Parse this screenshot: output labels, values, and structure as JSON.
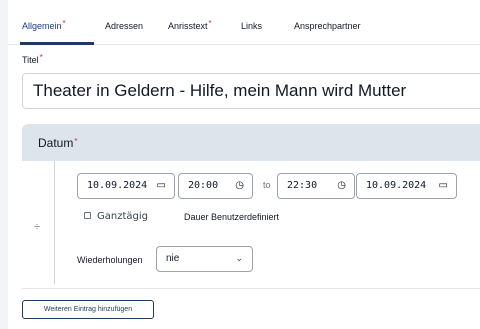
{
  "tabs": [
    {
      "label": "Allgemein",
      "required": "*"
    },
    {
      "label": "Adressen",
      "required": ""
    },
    {
      "label": "Anrisstext",
      "required": "*"
    },
    {
      "label": "Links",
      "required": ""
    },
    {
      "label": "Ansprechpartner",
      "required": ""
    }
  ],
  "title_field": {
    "label": "Titel",
    "required": "*",
    "value": "Theater in Geldern - Hilfe, mein Mann wird Mutter"
  },
  "datum": {
    "label": "Datum",
    "required": "*",
    "start_date": "10.09.2024",
    "start_time": "20:00",
    "separator": "to",
    "end_time": "22:30",
    "end_date": "10.09.2024",
    "all_day_label": "Ganztägig",
    "custom_duration_label": "Dauer Benutzerdefiniert",
    "repeat_label": "Wiederholungen",
    "repeat_value": "nie",
    "drag_handle_icon": "drag-handle-icon",
    "calendar_icon": "calendar-icon",
    "clock_icon": "clock-icon",
    "chevron_icon": "chevron-down-icon"
  },
  "add_entry_button": "Weiteren Eintrag hinzufügen",
  "colors": {
    "accent": "#1e3a5f",
    "required": "#e11d48",
    "section_header": "#dde4ec"
  }
}
